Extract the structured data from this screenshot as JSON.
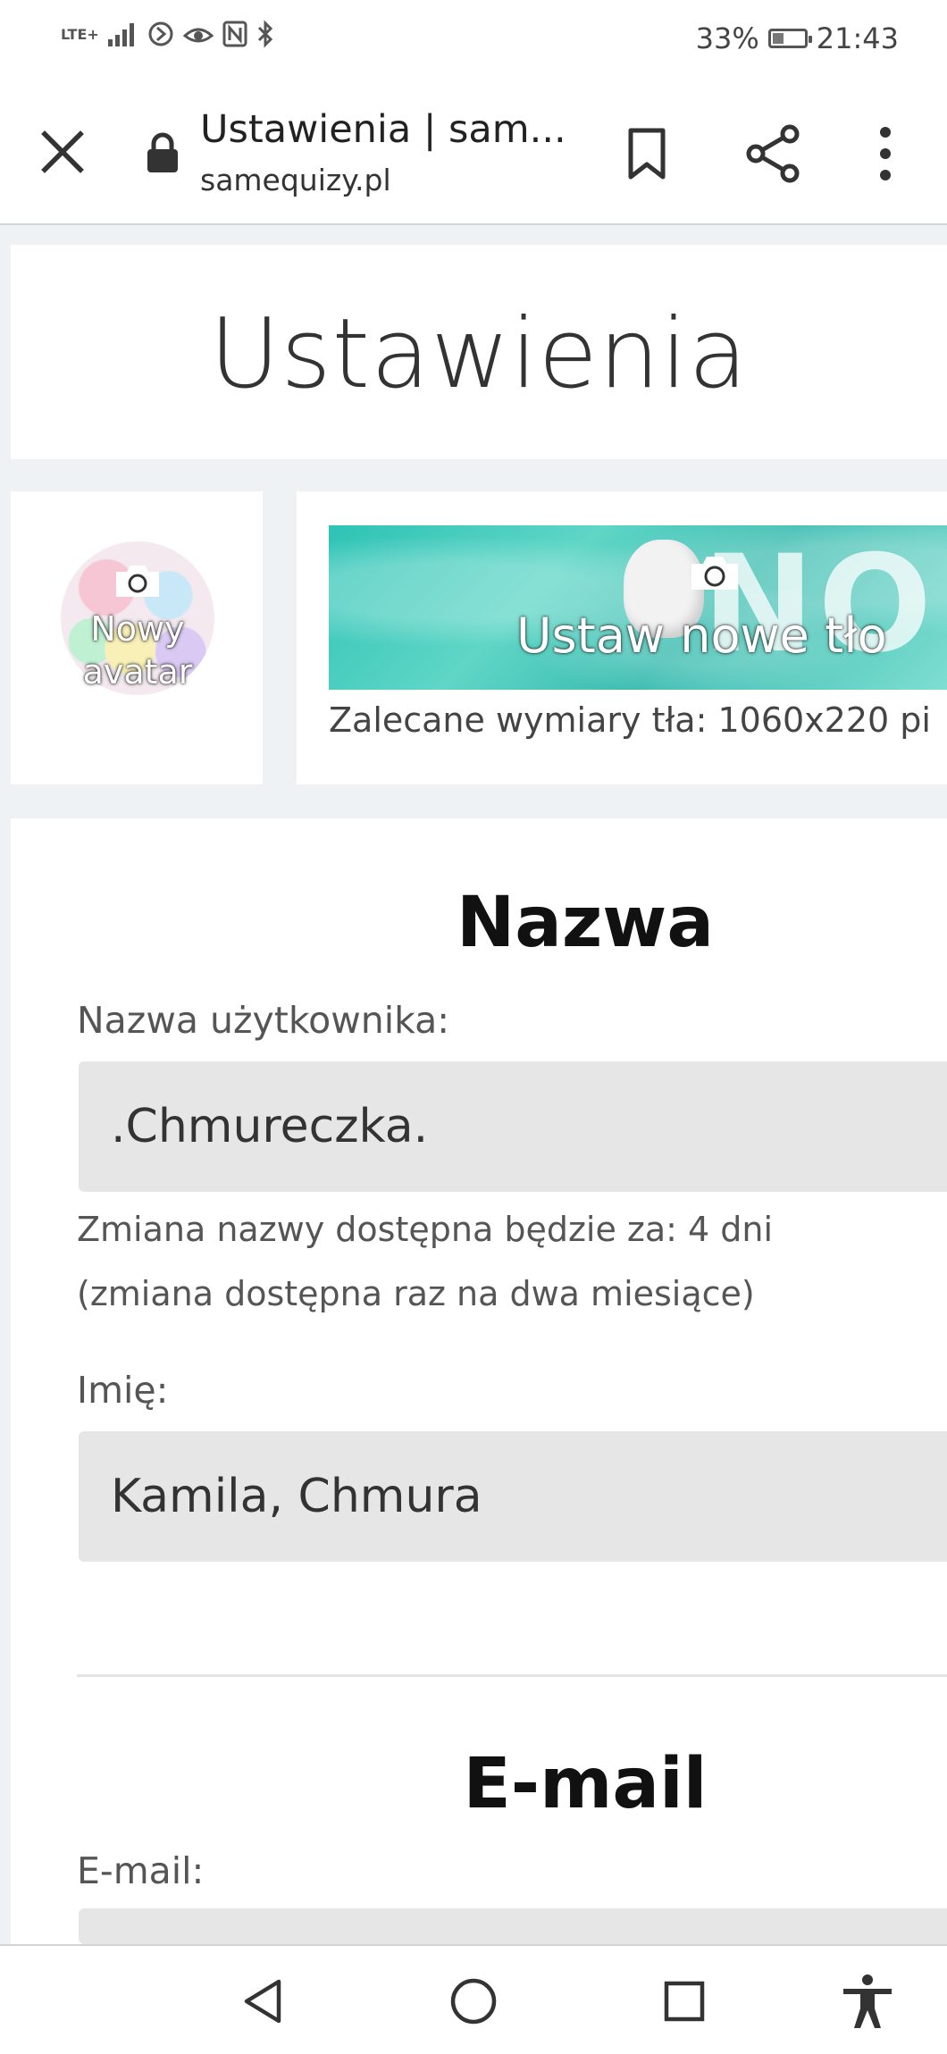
{
  "status_bar": {
    "network_label": "LTE+",
    "battery_percent": "33%",
    "battery_level": 0.33,
    "time": "21:43"
  },
  "browser": {
    "tab_title": "Ustawienia | sam...",
    "url": "samequizy.pl"
  },
  "page": {
    "title": "Ustawienia",
    "avatar": {
      "label_line1": "Nowy",
      "label_line2": "avatar"
    },
    "background": {
      "label": "Ustaw nowe tło",
      "banner_text": "NODD",
      "hint": "Zalecane wymiary tła: 1060x220 pi"
    },
    "name_section": {
      "heading": "Nazwa",
      "username_label": "Nazwa użytkownika:",
      "username_value": ".Chmureczka.",
      "change_note": "Zmiana nazwy dostępna będzie za: 4 dni",
      "change_frequency_note": "(zmiana dostępna raz na dwa miesiące)",
      "first_name_label": "Imię:",
      "first_name_value": "Kamila, Chmura"
    },
    "email_section": {
      "heading": "E-mail",
      "email_label": "E-mail:",
      "email_value": ""
    }
  },
  "colors": {
    "banner_accent": "#2ec3b5",
    "page_background": "#eef2f5",
    "input_background": "#e6e6e6"
  }
}
